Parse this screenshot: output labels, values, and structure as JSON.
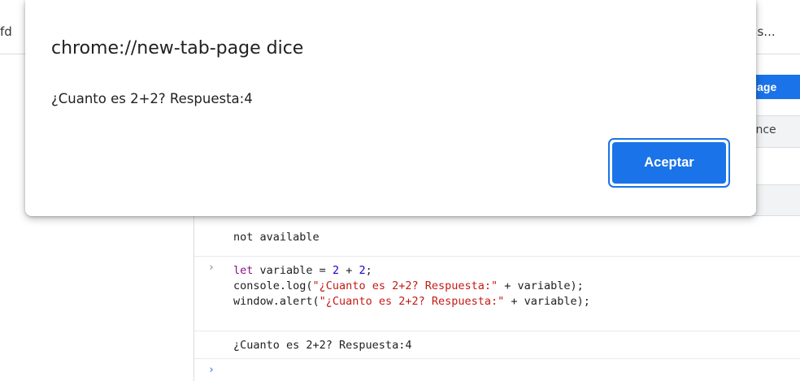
{
  "background": {
    "left_tab_fragment": "fd",
    "right_tab_fragment": "Bas...",
    "language_button_fragment": "guage",
    "tab_fragment": "nance"
  },
  "console": {
    "messages": [
      {
        "text": "not available"
      }
    ],
    "command": {
      "line1": {
        "kw": "let",
        "name": " variable ",
        "op": "= ",
        "n1": "2",
        "plus": " + ",
        "n2": "2",
        "end": ";"
      },
      "line2": {
        "pre": "console.log(",
        "str": "\"¿Cuanto es 2+2? Respuesta:\"",
        "post": " + variable);"
      },
      "line3": {
        "pre": "window.alert(",
        "str": "\"¿Cuanto es 2+2? Respuesta:\"",
        "post": " + variable);"
      }
    },
    "output": "¿Cuanto es 2+2? Respuesta:4",
    "prompt_glyph": "›",
    "input_prompt_glyph": "›"
  },
  "dialog": {
    "title": "chrome://new-tab-page dice",
    "message": "¿Cuanto es 2+2? Respuesta:4",
    "ok_label": "Aceptar"
  },
  "colors": {
    "accent": "#1a73e8",
    "keyword": "#881280",
    "number": "#1c00cf",
    "string": "#c41a16"
  }
}
